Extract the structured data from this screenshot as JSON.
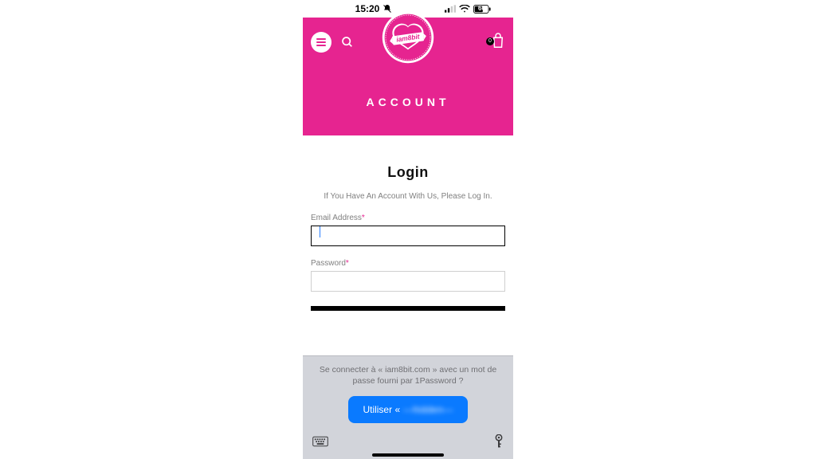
{
  "status": {
    "time": "15:20",
    "battery": "60"
  },
  "header": {
    "logo_text": "iam8bit",
    "cart_count": "0",
    "page_title": "ACCOUNT"
  },
  "login": {
    "heading": "Login",
    "subheading": "If You Have An Account With Us, Please Log In.",
    "email_label": "Email Address",
    "password_label": "Password",
    "required_mark": "*",
    "email_value": "",
    "password_value": ""
  },
  "keyboard_panel": {
    "prompt": "Se connecter à « iam8bit.com » avec un mot de passe fourni par 1Password ?",
    "button_prefix": "Utiliser «",
    "button_account": "—hidden—"
  }
}
